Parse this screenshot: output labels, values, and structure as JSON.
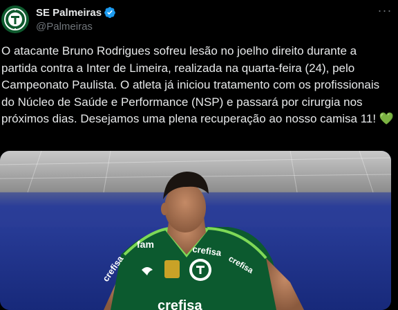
{
  "account": {
    "display_name": "SE Palmeiras",
    "handle": "@Palmeiras",
    "verified": true,
    "avatar_icon": "palmeiras-crest-icon"
  },
  "menu": {
    "more_icon": "more-horizontal-icon",
    "more_glyph": "···"
  },
  "tweet": {
    "text": "O atacante Bruno Rodrigues sofreu lesão no joelho direito durante a partida contra a Inter de Limeira, realizada na quarta-feira (24), pelo Campeonato Paulista. O atleta já iniciou tratamento com os profissionais do Núcleo de Saúde e Performance (NSP) e passará por cirurgia nos próximos dias. Desejamos uma plena recuperação ao nosso camisa 11!",
    "emoji": "💚"
  },
  "media": {
    "description_icon": "player-photo",
    "shirt_text": [
      "fam",
      "crefisa",
      "crefisa",
      "crefisa"
    ]
  },
  "colors": {
    "background": "#000000",
    "text": "#e7e9ea",
    "secondary": "#71767b",
    "verified": "#1d9bf0",
    "palmeiras_green": "#0f5a2e",
    "heart": "#3fb950"
  }
}
